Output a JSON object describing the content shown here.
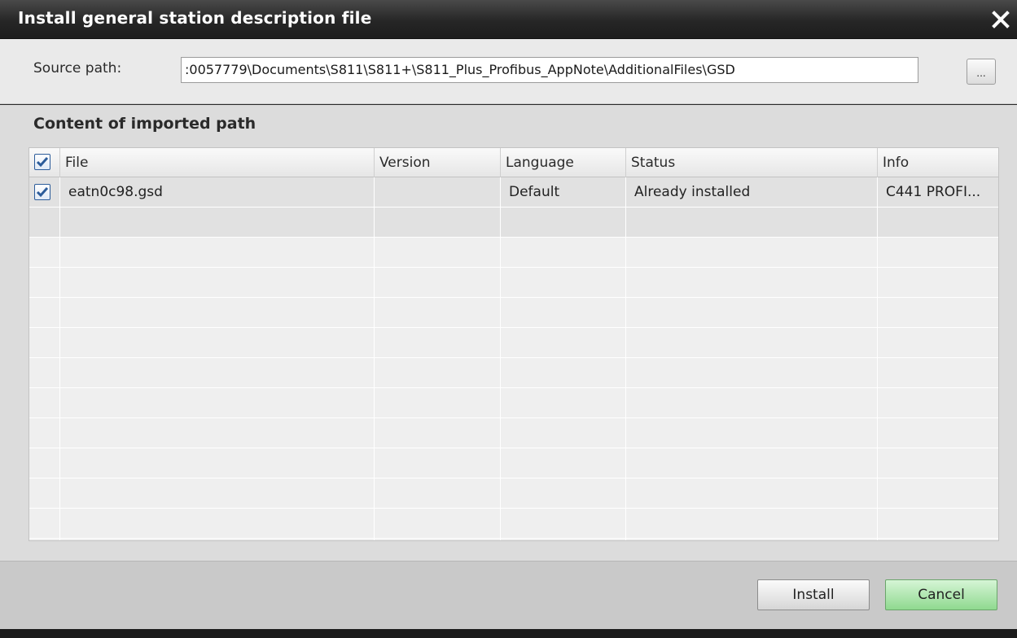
{
  "window": {
    "title": "Install general station description file",
    "close_label": "Close"
  },
  "source": {
    "label": "Source path:",
    "value": ":0057779\\Documents\\S811\\S811+\\S811_Plus_Profibus_AppNote\\AdditionalFiles\\GSD",
    "browse_label": "..."
  },
  "content": {
    "title": "Content of imported path",
    "columns": [
      "File",
      "Version",
      "Language",
      "Status",
      "Info"
    ],
    "rows": [
      {
        "checked": true,
        "file": "eatn0c98.gsd",
        "version": "",
        "language": "Default",
        "status": "Already installed",
        "info": "C441 PROFI..."
      }
    ]
  },
  "footer": {
    "install_label": "Install",
    "cancel_label": "Cancel"
  },
  "colors": {
    "titlebar": "#262626",
    "cancel_button": "#8fd98f",
    "checkbox_check": "#2c5c9a"
  }
}
